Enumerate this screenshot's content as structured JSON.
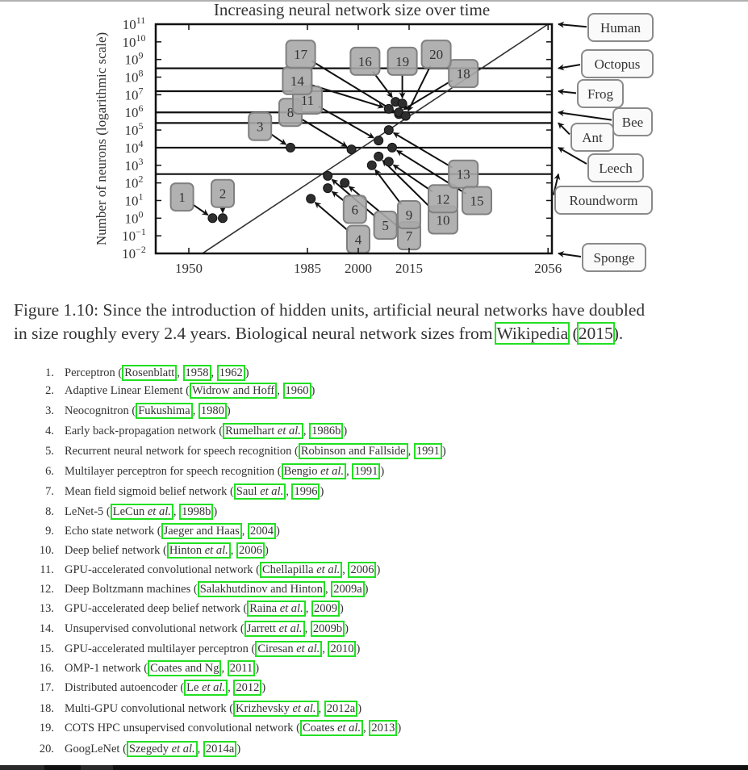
{
  "chart_data": {
    "type": "scatter",
    "title": "Increasing neural network size over time",
    "xlabel": "",
    "ylabel": "Number of neurons (logarithmic scale)",
    "xlim": [
      1940,
      2056
    ],
    "ylim_exponent": [
      -2,
      11
    ],
    "yscale": "log10",
    "x_ticks": [
      1950,
      1985,
      2000,
      2015,
      2056
    ],
    "y_ticks": [
      "10^11",
      "10^10",
      "10^9",
      "10^8",
      "10^7",
      "10^6",
      "10^5",
      "10^4",
      "10^3",
      "10^2",
      "10^1",
      "10^0",
      "10^-1",
      "10^-2"
    ],
    "y_tick_exponents": [
      11,
      10,
      9,
      8,
      7,
      6,
      5,
      4,
      3,
      2,
      1,
      0,
      -1,
      -2
    ],
    "grid": false,
    "trend_line": {
      "label": "",
      "from": [
        1954,
        -2
      ],
      "to": [
        2056,
        11
      ]
    },
    "points": [
      {
        "id": "1",
        "year": 1957,
        "log_neurons": 0.0
      },
      {
        "id": "2",
        "year": 1960,
        "log_neurons": 0.0
      },
      {
        "id": "3",
        "year": 1980,
        "log_neurons": 4.0
      },
      {
        "id": "4",
        "year": 1986,
        "log_neurons": 1.1
      },
      {
        "id": "5",
        "year": 1991,
        "log_neurons": 2.4
      },
      {
        "id": "6",
        "year": 1991,
        "log_neurons": 1.7
      },
      {
        "id": "7",
        "year": 1996,
        "log_neurons": 2.0
      },
      {
        "id": "8",
        "year": 1998,
        "log_neurons": 3.9
      },
      {
        "id": "9",
        "year": 2004,
        "log_neurons": 3.0
      },
      {
        "id": "10",
        "year": 2006,
        "log_neurons": 3.5
      },
      {
        "id": "11",
        "year": 2006,
        "log_neurons": 4.4
      },
      {
        "id": "12",
        "year": 2009,
        "log_neurons": 3.2
      },
      {
        "id": "13",
        "year": 2009,
        "log_neurons": 5.0
      },
      {
        "id": "14",
        "year": 2009,
        "log_neurons": 6.2
      },
      {
        "id": "15",
        "year": 2010,
        "log_neurons": 4.0
      },
      {
        "id": "16",
        "year": 2011,
        "log_neurons": 6.6
      },
      {
        "id": "17",
        "year": 2012,
        "log_neurons": 5.9
      },
      {
        "id": "18",
        "year": 2012,
        "log_neurons": 6.0
      },
      {
        "id": "19",
        "year": 2013,
        "log_neurons": 6.5
      },
      {
        "id": "20",
        "year": 2014,
        "log_neurons": 5.8
      }
    ],
    "point_labels": [
      {
        "id": "1",
        "label_year": 1948,
        "label_log": 1.2
      },
      {
        "id": "2",
        "label_year": 1960,
        "label_log": 1.4
      },
      {
        "id": "3",
        "label_year": 1971,
        "label_log": 5.2
      },
      {
        "id": "4",
        "label_year": 2000,
        "label_log": -1.2
      },
      {
        "id": "5",
        "label_year": 2008,
        "label_log": -0.4
      },
      {
        "id": "6",
        "label_year": 1999,
        "label_log": 0.5
      },
      {
        "id": "7",
        "label_year": 2015,
        "label_log": -1.0
      },
      {
        "id": "8",
        "label_year": 1980,
        "label_log": 6.0
      },
      {
        "id": "9",
        "label_year": 2015,
        "label_log": 0.2
      },
      {
        "id": "10",
        "label_year": 2025,
        "label_log": -0.1
      },
      {
        "id": "11",
        "label_year": 1985,
        "label_log": 6.7
      },
      {
        "id": "12",
        "label_year": 2025,
        "label_log": 1.1
      },
      {
        "id": "13",
        "label_year": 2031,
        "label_log": 2.5
      },
      {
        "id": "14",
        "label_year": 1982,
        "label_log": 7.8
      },
      {
        "id": "15",
        "label_year": 2035,
        "label_log": 1.0
      },
      {
        "id": "16",
        "label_year": 2002,
        "label_log": 8.9
      },
      {
        "id": "17",
        "label_year": 1983,
        "label_log": 9.3
      },
      {
        "id": "18",
        "label_year": 2031,
        "label_log": 8.2
      },
      {
        "id": "19",
        "label_year": 2013,
        "label_log": 8.9
      },
      {
        "id": "20",
        "label_year": 2023,
        "label_log": 9.3
      }
    ],
    "reference_lines": [
      {
        "name": "Human",
        "log_neurons": 11.0
      },
      {
        "name": "Octopus",
        "log_neurons": 8.5
      },
      {
        "name": "Frog",
        "log_neurons": 7.2
      },
      {
        "name": "Bee",
        "log_neurons": 6.0
      },
      {
        "name": "Ant",
        "log_neurons": 5.4
      },
      {
        "name": "Leech",
        "log_neurons": 4.0
      },
      {
        "name": "Roundworm",
        "log_neurons": 2.5
      },
      {
        "name": "Sponge",
        "log_neurons": -2.0
      }
    ],
    "annotations": [
      "Human",
      "Octopus",
      "Frog",
      "Bee",
      "Ant",
      "Leech",
      "Roundworm",
      "Sponge"
    ]
  },
  "caption": {
    "label": "Figure 1.10:",
    "text_line1": " Since the introduction of hidden units, artificial neural networks have doubled",
    "text_line2_before": "in size roughly every 2.4 years. Biological neural network sizes from ",
    "cite_author": "Wikipedia",
    "cite_year": "2015",
    "text_line2_after": ")."
  },
  "references": [
    {
      "num": "1.",
      "name": "Perceptron",
      "author": "Rosenblatt",
      "etal": false,
      "years": [
        "1958",
        "1962"
      ]
    },
    {
      "num": "2.",
      "name": "Adaptive Linear Element",
      "author": "Widrow and Hoff",
      "etal": false,
      "years": [
        "1960"
      ]
    },
    {
      "num": "3.",
      "name": "Neocognitron",
      "author": "Fukushima",
      "etal": false,
      "years": [
        "1980"
      ]
    },
    {
      "num": "4.",
      "name": "Early back-propagation network",
      "author": "Rumelhart",
      "etal": true,
      "years": [
        "1986b"
      ]
    },
    {
      "num": "5.",
      "name": "Recurrent neural network for speech recognition",
      "author": "Robinson and Fallside",
      "etal": false,
      "years": [
        "1991"
      ]
    },
    {
      "num": "6.",
      "name": "Multilayer perceptron for speech recognition",
      "author": "Bengio",
      "etal": true,
      "years": [
        "1991"
      ]
    },
    {
      "num": "7.",
      "name": "Mean field sigmoid belief network",
      "author": "Saul",
      "etal": true,
      "years": [
        "1996"
      ]
    },
    {
      "num": "8.",
      "name": "LeNet-5",
      "author": "LeCun",
      "etal": true,
      "years": [
        "1998b"
      ]
    },
    {
      "num": "9.",
      "name": "Echo state network",
      "author": "Jaeger and Haas",
      "etal": false,
      "years": [
        "2004"
      ]
    },
    {
      "num": "10.",
      "name": "Deep belief network",
      "author": "Hinton",
      "etal": true,
      "years": [
        "2006"
      ]
    },
    {
      "num": "11.",
      "name": "GPU-accelerated convolutional network",
      "author": "Chellapilla",
      "etal": true,
      "years": [
        "2006"
      ]
    },
    {
      "num": "12.",
      "name": "Deep Boltzmann machines",
      "author": "Salakhutdinov and Hinton",
      "etal": false,
      "years": [
        "2009a"
      ]
    },
    {
      "num": "13.",
      "name": "GPU-accelerated deep belief network",
      "author": "Raina",
      "etal": true,
      "years": [
        "2009"
      ]
    },
    {
      "num": "14.",
      "name": "Unsupervised convolutional network",
      "author": "Jarrett",
      "etal": true,
      "years": [
        "2009b"
      ]
    },
    {
      "num": "15.",
      "name": "GPU-accelerated multilayer perceptron",
      "author": "Ciresan",
      "etal": true,
      "years": [
        "2010"
      ]
    },
    {
      "num": "16.",
      "name": "OMP-1 network",
      "author": "Coates and Ng",
      "etal": false,
      "years": [
        "2011"
      ]
    },
    {
      "num": "17.",
      "name": "Distributed autoencoder",
      "author": "Le",
      "etal": true,
      "years": [
        "2012"
      ]
    },
    {
      "num": "18.",
      "name": "Multi-GPU convolutional network",
      "author": "Krizhevsky",
      "etal": true,
      "years": [
        "2012a"
      ]
    },
    {
      "num": "19.",
      "name": "COTS HPC unsupervised convolutional network",
      "author": "Coates",
      "etal": true,
      "years": [
        "2013"
      ]
    },
    {
      "num": "20.",
      "name": "GoogLeNet",
      "author": "Szegedy",
      "etal": true,
      "years": [
        "2014a"
      ]
    }
  ],
  "etal_text": "et al.",
  "colors": {
    "highlight": "#22e022",
    "label_box_fill": "#a8a8a8",
    "label_box_stroke": "#808080",
    "ref_box_fill": "#fafafa",
    "ink": "#222222"
  }
}
